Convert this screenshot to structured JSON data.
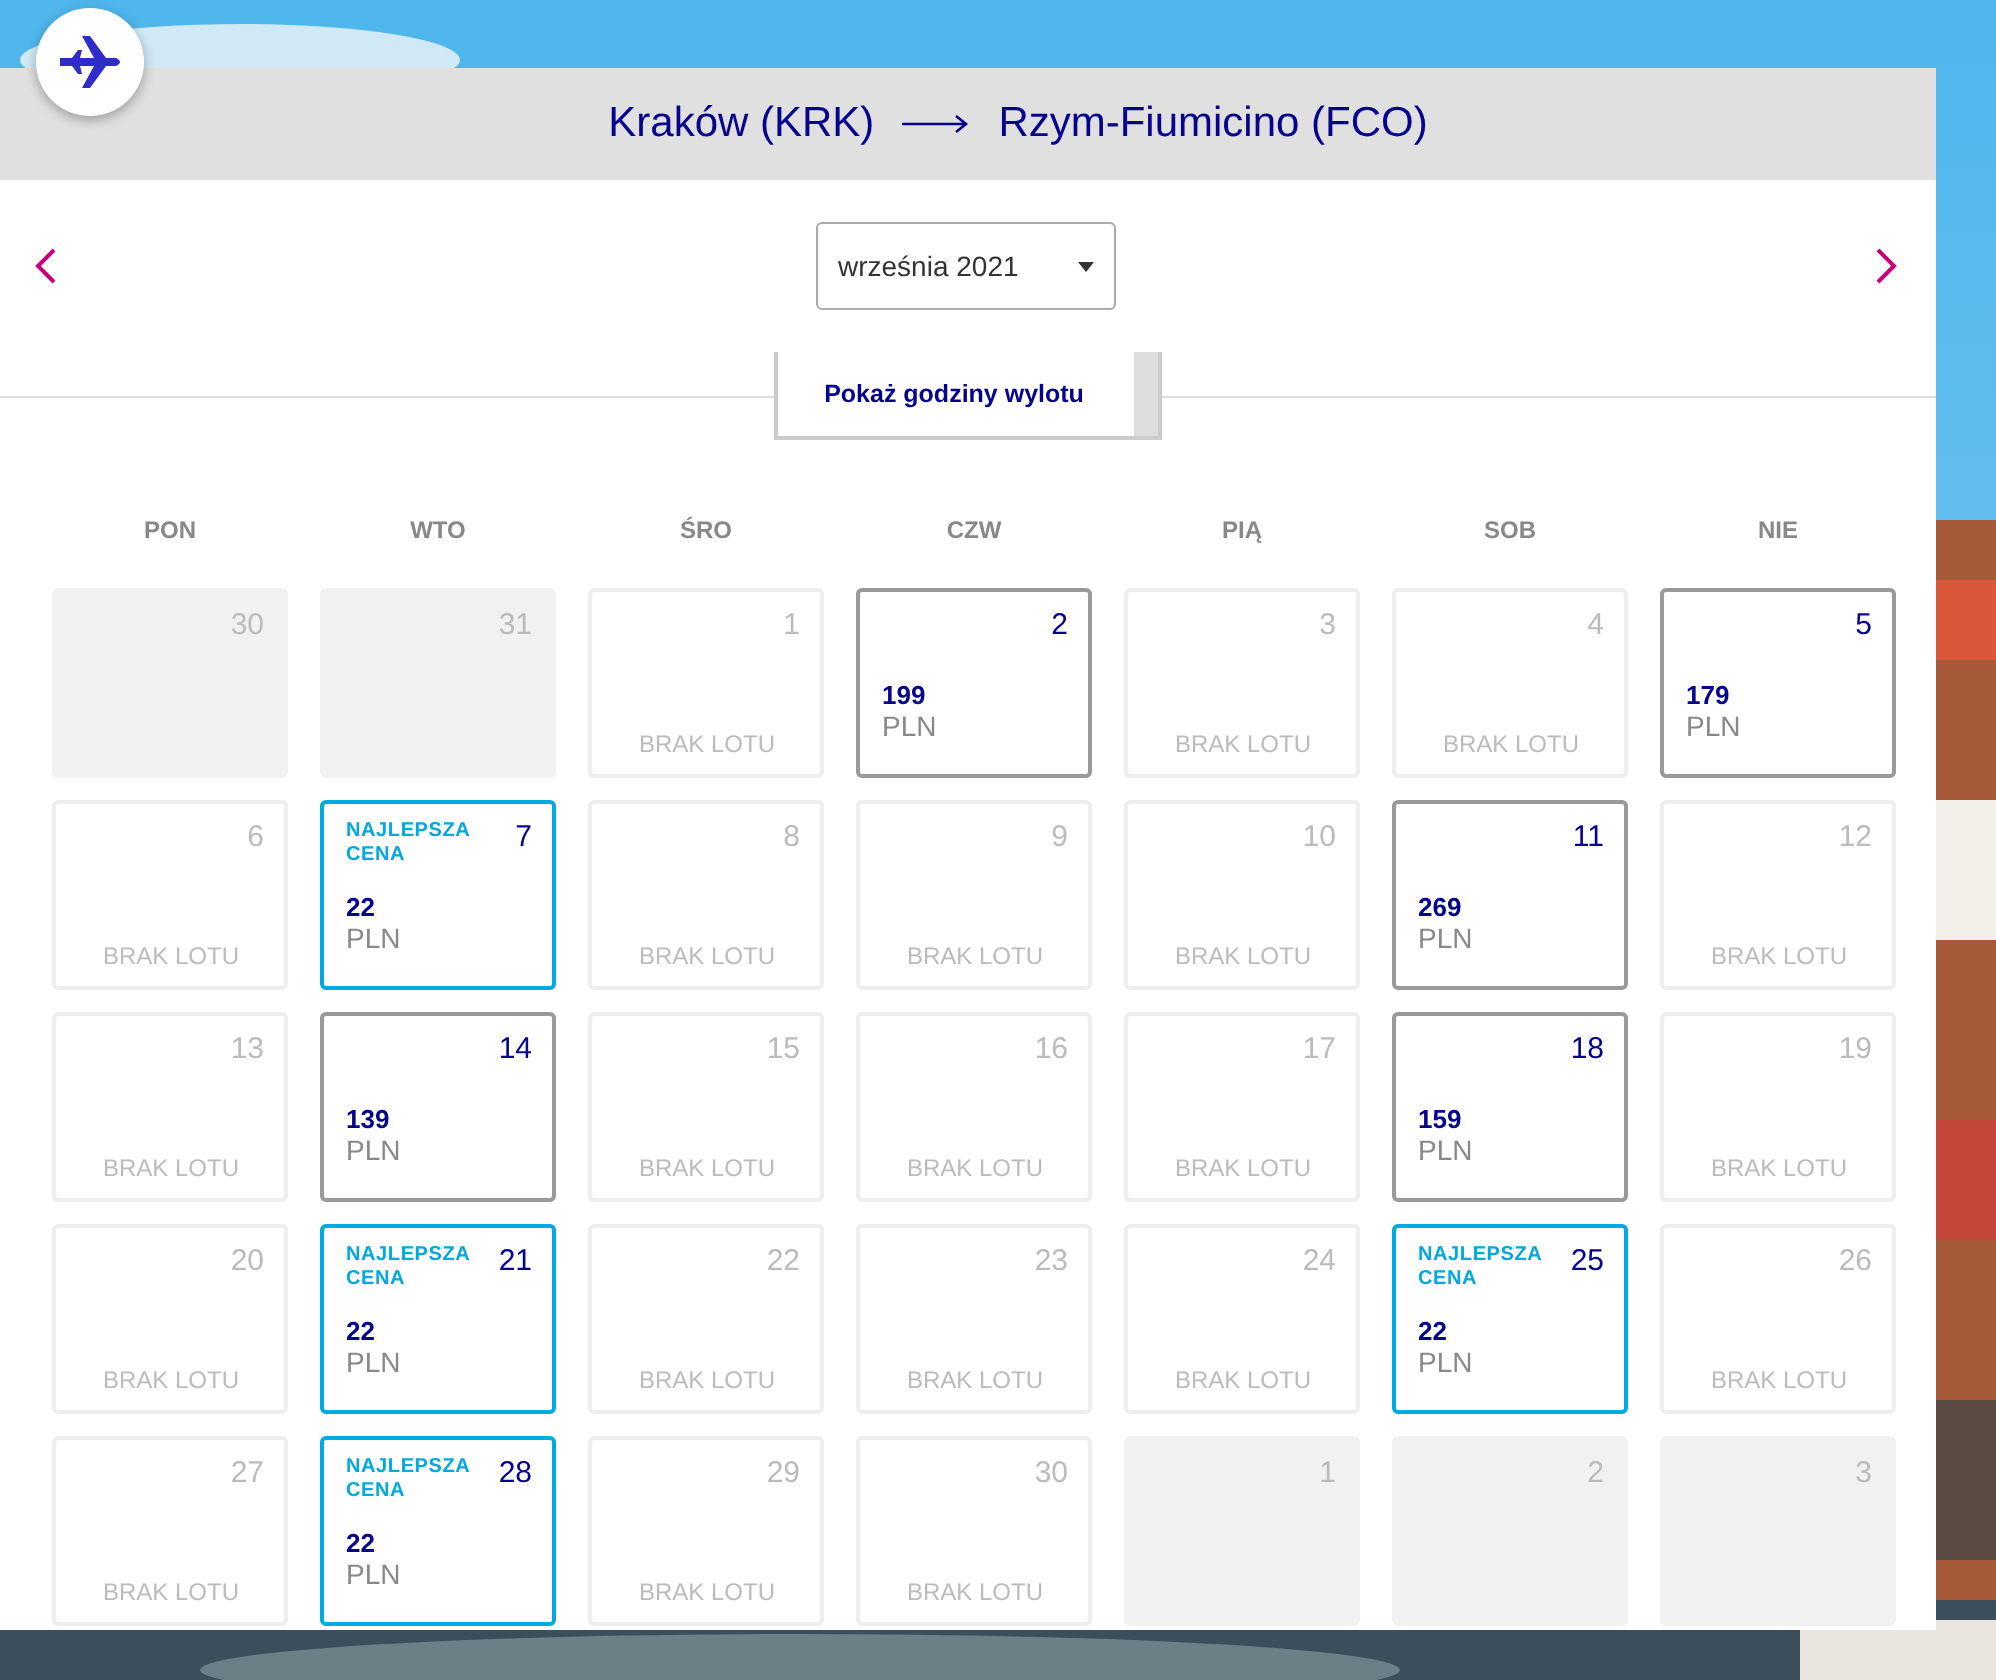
{
  "route": {
    "origin": "Kraków (KRK)",
    "destination": "Rzym-Fiumicino (FCO)"
  },
  "month_select": {
    "value": "września 2021"
  },
  "toggle_button": {
    "label": "Pokaż godziny wylotu"
  },
  "weekdays": [
    "PON",
    "WTO",
    "ŚRO",
    "CZW",
    "PIĄ",
    "SOB",
    "NIE"
  ],
  "days": [
    {
      "kind": "outside",
      "day": "30"
    },
    {
      "kind": "outside",
      "day": "31"
    },
    {
      "kind": "none",
      "day": "1",
      "note": "BRAK LOTU"
    },
    {
      "kind": "price",
      "day": "2",
      "price": "199",
      "currency": "PLN"
    },
    {
      "kind": "none",
      "day": "3",
      "note": "BRAK LOTU"
    },
    {
      "kind": "none",
      "day": "4",
      "note": "BRAK LOTU"
    },
    {
      "kind": "price",
      "day": "5",
      "price": "179",
      "currency": "PLN"
    },
    {
      "kind": "none",
      "day": "6",
      "note": "BRAK LOTU"
    },
    {
      "kind": "best",
      "day": "7",
      "badge": "NAJLEPSZA CENA",
      "price": "22",
      "currency": "PLN"
    },
    {
      "kind": "none",
      "day": "8",
      "note": "BRAK LOTU"
    },
    {
      "kind": "none",
      "day": "9",
      "note": "BRAK LOTU"
    },
    {
      "kind": "none",
      "day": "10",
      "note": "BRAK LOTU"
    },
    {
      "kind": "price",
      "day": "11",
      "price": "269",
      "currency": "PLN"
    },
    {
      "kind": "none",
      "day": "12",
      "note": "BRAK LOTU"
    },
    {
      "kind": "none",
      "day": "13",
      "note": "BRAK LOTU"
    },
    {
      "kind": "price",
      "day": "14",
      "price": "139",
      "currency": "PLN"
    },
    {
      "kind": "none",
      "day": "15",
      "note": "BRAK LOTU"
    },
    {
      "kind": "none",
      "day": "16",
      "note": "BRAK LOTU"
    },
    {
      "kind": "none",
      "day": "17",
      "note": "BRAK LOTU"
    },
    {
      "kind": "price",
      "day": "18",
      "price": "159",
      "currency": "PLN"
    },
    {
      "kind": "none",
      "day": "19",
      "note": "BRAK LOTU"
    },
    {
      "kind": "none",
      "day": "20",
      "note": "BRAK LOTU"
    },
    {
      "kind": "best",
      "day": "21",
      "badge": "NAJLEPSZA CENA",
      "price": "22",
      "currency": "PLN"
    },
    {
      "kind": "none",
      "day": "22",
      "note": "BRAK LOTU"
    },
    {
      "kind": "none",
      "day": "23",
      "note": "BRAK LOTU"
    },
    {
      "kind": "none",
      "day": "24",
      "note": "BRAK LOTU"
    },
    {
      "kind": "best",
      "day": "25",
      "badge": "NAJLEPSZA CENA",
      "price": "22",
      "currency": "PLN"
    },
    {
      "kind": "none",
      "day": "26",
      "note": "BRAK LOTU"
    },
    {
      "kind": "none",
      "day": "27",
      "note": "BRAK LOTU"
    },
    {
      "kind": "best",
      "day": "28",
      "badge": "NAJLEPSZA CENA",
      "price": "22",
      "currency": "PLN"
    },
    {
      "kind": "none",
      "day": "29",
      "note": "BRAK LOTU"
    },
    {
      "kind": "none",
      "day": "30",
      "note": "BRAK LOTU"
    },
    {
      "kind": "outside",
      "day": "1"
    },
    {
      "kind": "outside",
      "day": "2"
    },
    {
      "kind": "outside",
      "day": "3"
    }
  ]
}
